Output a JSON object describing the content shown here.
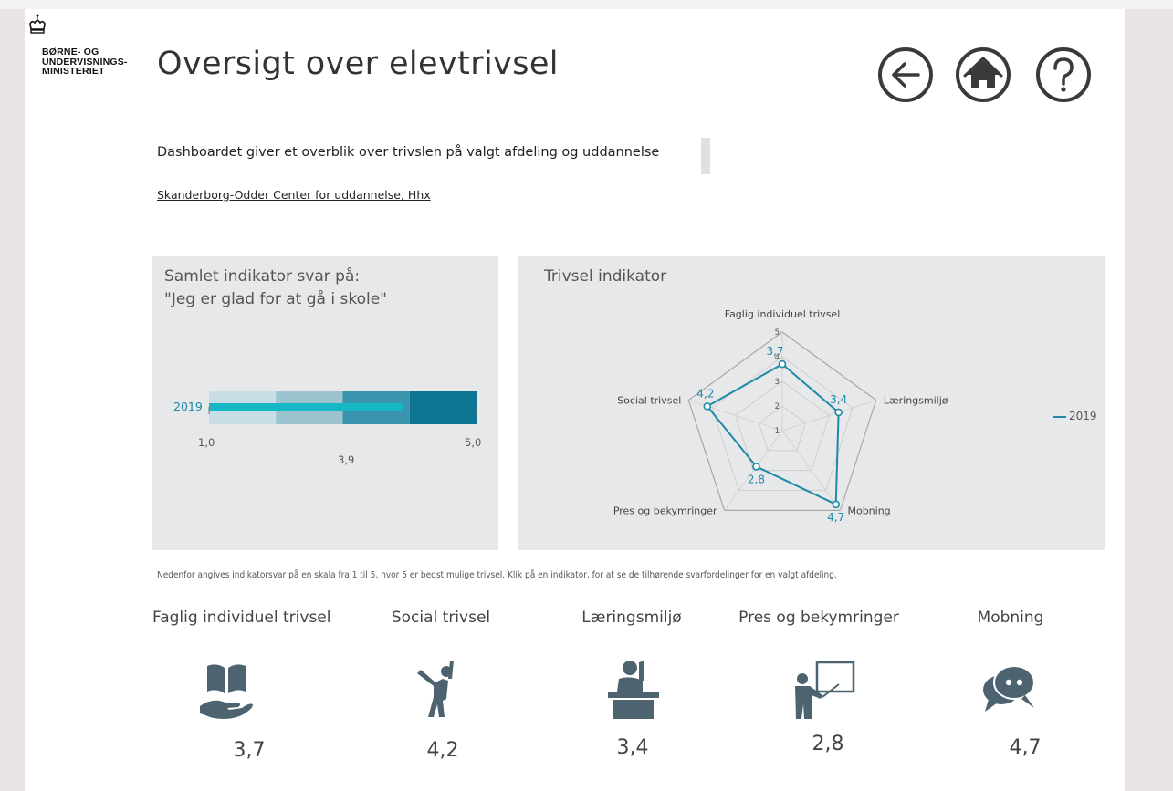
{
  "logo": {
    "lines": [
      "BØRNE- OG",
      "UNDERVISNINGS-",
      "MINISTERIET"
    ],
    "icon": "crown-icon"
  },
  "header": {
    "title": "Oversigt over elevtrivsel",
    "nav": [
      {
        "name": "back-button",
        "icon": "arrow-left-icon"
      },
      {
        "name": "home-button",
        "icon": "home-icon"
      },
      {
        "name": "help-button",
        "icon": "question-icon"
      }
    ]
  },
  "intro": {
    "description": "Dashboardet giver et overblik over trivslen på valgt afdeling og uddannelse",
    "selection": "Skanderborg-Odder Center for uddannelse, Hhx"
  },
  "gauge_panel": {
    "title_line1": "Samlet indikator svar på:",
    "title_line2": "\"Jeg er glad for at gå i skole\"",
    "year": "2019",
    "min_label": "1,0",
    "max_label": "5,0",
    "value_label": "3,9"
  },
  "radar_panel": {
    "title": "Trivsel indikator",
    "legend": "2019"
  },
  "note": "Nedenfor angives indikatorsvar på en skala fra 1 til 5, hvor 5 er bedst mulige trivsel. Klik på en indikator, for at se de tilhørende svarfordelinger for en valgt afdeling.",
  "indicators": [
    {
      "label": "Faglig individuel trivsel",
      "value": "3,7",
      "icon": "book-hand-icon"
    },
    {
      "label": "Social trivsel",
      "value": "4,2",
      "icon": "cheering-person-icon"
    },
    {
      "label": "Læringsmiljø",
      "value": "3,4",
      "icon": "student-desk-icon"
    },
    {
      "label": "Pres og bekymringer",
      "value": "2,8",
      "icon": "teacher-board-icon"
    },
    {
      "label": "Mobning",
      "value": "4,7",
      "icon": "speech-bubbles-icon"
    }
  ],
  "colors": {
    "accent": "#1f8aa8",
    "gauge_light": "#c9dde6",
    "gauge_mid": "#9cc3d0",
    "gauge_dark": "#3a94ad",
    "gauge_darkest": "#0d7591",
    "gauge_bar": "#17b7c6",
    "icon": "#4d6470"
  },
  "chart_data": [
    {
      "type": "bar",
      "categories": [
        "2019"
      ],
      "values": [
        3.9
      ],
      "xlim": [
        1,
        5
      ],
      "bands": [
        1,
        2,
        3,
        4,
        5
      ],
      "title": "Samlet indikator svar på: \"Jeg er glad for at gå i skole\""
    },
    {
      "type": "radar",
      "title": "Trivsel indikator",
      "categories": [
        "Faglig individuel trivsel",
        "Læringsmiljø",
        "Mobning",
        "Pres og bekymringer",
        "Social trivsel"
      ],
      "series": [
        {
          "name": "2019",
          "values": [
            3.7,
            3.4,
            4.7,
            2.8,
            4.2
          ]
        }
      ],
      "value_labels": [
        "3,7",
        "3,4",
        "4,7",
        "2,8",
        "4,2"
      ],
      "range": [
        1,
        5
      ],
      "ticks": [
        "1",
        "2",
        "3",
        "4",
        "5"
      ],
      "legend": "right"
    }
  ]
}
